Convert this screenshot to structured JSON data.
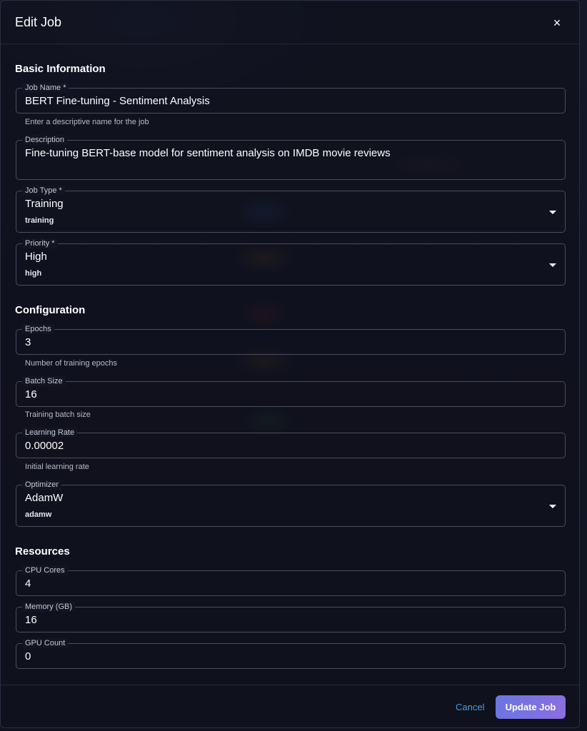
{
  "dialog": {
    "title": "Edit Job",
    "close_icon": "×"
  },
  "sections": {
    "basic": "Basic Information",
    "configuration": "Configuration",
    "resources": "Resources"
  },
  "fields": {
    "job_name": {
      "label": "Job Name *",
      "value": "BERT Fine-tuning - Sentiment Analysis",
      "helper": "Enter a descriptive name for the job"
    },
    "description": {
      "label": "Description",
      "value": "Fine-tuning BERT-base model for sentiment analysis on IMDB movie reviews"
    },
    "job_type": {
      "label": "Job Type *",
      "value": "Training",
      "subvalue": "training"
    },
    "priority": {
      "label": "Priority *",
      "value": "High",
      "subvalue": "high"
    },
    "epochs": {
      "label": "Epochs",
      "value": "3",
      "helper": "Number of training epochs"
    },
    "batch_size": {
      "label": "Batch Size",
      "value": "16",
      "helper": "Training batch size"
    },
    "learning_rate": {
      "label": "Learning Rate",
      "value": "0.00002",
      "helper": "Initial learning rate"
    },
    "optimizer": {
      "label": "Optimizer",
      "value": "AdamW",
      "subvalue": "adamw"
    },
    "cpu_cores": {
      "label": "CPU Cores",
      "value": "4"
    },
    "memory": {
      "label": "Memory (GB)",
      "value": "16"
    },
    "gpu_count": {
      "label": "GPU Count",
      "value": "0"
    }
  },
  "actions": {
    "cancel": "Cancel",
    "update": "Update Job"
  },
  "colors": {
    "accent_link": "#4a9fe6",
    "button_gradient_start": "#6b75e0",
    "button_gradient_end": "#8a6fe0"
  }
}
